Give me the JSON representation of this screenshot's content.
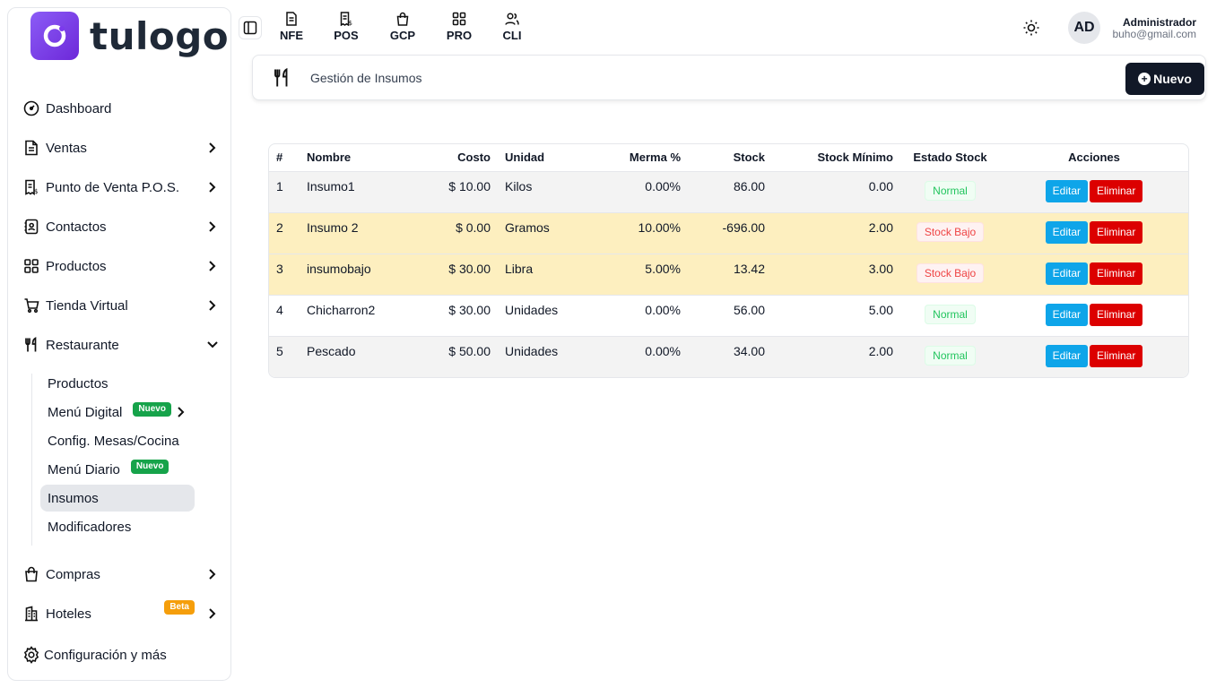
{
  "brand": {
    "name": "tulogo"
  },
  "sidebar": {
    "items": [
      {
        "label": "Dashboard",
        "icon": "gauge-icon"
      },
      {
        "label": "Ventas",
        "icon": "document-icon"
      },
      {
        "label": "Punto de Venta P.O.S.",
        "icon": "receipt-icon"
      },
      {
        "label": "Contactos",
        "icon": "contacts-icon"
      },
      {
        "label": "Productos",
        "icon": "grid-icon"
      },
      {
        "label": "Tienda Virtual",
        "icon": "cart-icon"
      },
      {
        "label": "Restaurante",
        "icon": "utensils-icon"
      },
      {
        "label": "Compras",
        "icon": "shopping-bag-icon"
      },
      {
        "label": "Hoteles",
        "icon": "building-icon",
        "badge": "Beta"
      },
      {
        "label": "Configuración y más",
        "icon": "gear-icon"
      }
    ],
    "restaurante_sub": [
      {
        "label": "Productos"
      },
      {
        "label": "Menú Digital",
        "badge": "Nuevo"
      },
      {
        "label": "Config. Mesas/Cocina"
      },
      {
        "label": "Menú Diario",
        "badge": "Nuevo"
      },
      {
        "label": "Insumos",
        "active": true
      },
      {
        "label": "Modificadores"
      }
    ]
  },
  "topbar": {
    "modules": [
      {
        "label": "NFE",
        "icon": "file-text-icon"
      },
      {
        "label": "POS",
        "icon": "receipt-icon"
      },
      {
        "label": "GCP",
        "icon": "shopping-bag-icon"
      },
      {
        "label": "PRO",
        "icon": "grid-icon"
      },
      {
        "label": "CLI",
        "icon": "users-icon"
      }
    ],
    "user": {
      "initials": "AD",
      "name": "Administrador",
      "email": "buho@gmail.com"
    }
  },
  "header": {
    "title": "Gestión de Insumos",
    "new_label": "Nuevo"
  },
  "table": {
    "columns": [
      "#",
      "Nombre",
      "Costo",
      "Unidad",
      "Merma %",
      "Stock",
      "Stock Mínimo",
      "Estado Stock",
      "Acciones"
    ],
    "rows": [
      {
        "n": "1",
        "nombre": "Insumo1",
        "costo": "$ 10.00",
        "unidad": "Kilos",
        "merma": "0.00%",
        "stock": "86.00",
        "minimo": "0.00",
        "estado": "Normal"
      },
      {
        "n": "2",
        "nombre": "Insumo 2",
        "costo": "$ 0.00",
        "unidad": "Gramos",
        "merma": "10.00%",
        "stock": "-696.00",
        "minimo": "2.00",
        "estado": "Stock Bajo"
      },
      {
        "n": "3",
        "nombre": "insumobajo",
        "costo": "$ 30.00",
        "unidad": "Libra",
        "merma": "5.00%",
        "stock": "13.42",
        "minimo": "3.00",
        "estado": "Stock Bajo"
      },
      {
        "n": "4",
        "nombre": "Chicharron2",
        "costo": "$ 30.00",
        "unidad": "Unidades",
        "merma": "0.00%",
        "stock": "56.00",
        "minimo": "5.00",
        "estado": "Normal"
      },
      {
        "n": "5",
        "nombre": "Pescado",
        "costo": "$ 50.00",
        "unidad": "Unidades",
        "merma": "0.00%",
        "stock": "34.00",
        "minimo": "2.00",
        "estado": "Normal"
      }
    ],
    "edit_label": "Editar",
    "delete_label": "Eliminar"
  },
  "colors": {
    "brand": "#7c3aed",
    "primary_dark": "#111827",
    "edit": "#0ea5e9",
    "delete": "#dc0000",
    "low_row": "#fdefbf"
  }
}
